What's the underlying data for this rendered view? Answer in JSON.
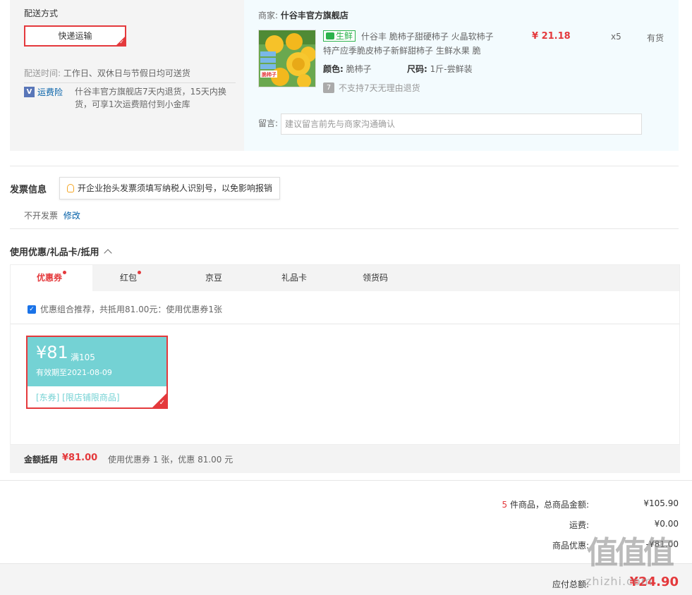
{
  "shipping": {
    "title": "配送方式",
    "method": "快递运输",
    "time_label": "配送时间:",
    "time_value": "工作日、双休日与节假日均可送货",
    "insurance_icon": "V",
    "insurance_label": "运费险",
    "insurance_desc": "什谷丰官方旗舰店7天内退货，15天内换货，可享1次运费赔付到小金库"
  },
  "vendor": {
    "label": "商家:",
    "name": "什谷丰官方旗舰店",
    "product": {
      "fresh_tag": "生鲜",
      "title": "什谷丰 脆柿子甜硬柿子 火晶软柿子特产应季脆皮柿子新鲜甜柿子 生鲜水果 脆",
      "price": "¥ 21.18",
      "qty": "x5",
      "stock": "有货",
      "color_label": "颜色:",
      "color_value": "脆柿子",
      "size_label": "尺码:",
      "size_value": "1斤-尝鲜装",
      "return_icon": "7",
      "return_text": "不支持7天无理由退货",
      "image_caption": "脆柿子"
    },
    "note_label": "留言:",
    "note_placeholder": "建议留言前先与商家沟通确认"
  },
  "invoice": {
    "title": "发票信息",
    "tip": "开企业抬头发票须填写纳税人识别号，以免影响报销",
    "value": "不开发票",
    "edit": "修改"
  },
  "discount": {
    "title": "使用优惠/礼品卡/抵用",
    "tabs": [
      {
        "label": "优惠券",
        "dot": true
      },
      {
        "label": "红包",
        "dot": true
      },
      {
        "label": "京豆",
        "dot": false
      },
      {
        "label": "礼品卡",
        "dot": false
      },
      {
        "label": "领货码",
        "dot": false
      }
    ],
    "combo_text": "优惠组合推荐，共抵用81.00元：使用优惠券1张",
    "coupon": {
      "amount": "¥81",
      "condition": "满105",
      "expire": "有效期至2021-08-09",
      "scope": "[东券] [限店铺限商品]"
    },
    "summary_label": "金额抵用",
    "summary_amount": "¥81.00",
    "summary_detail": "使用优惠券 1 张，优惠 81.00 元"
  },
  "totals": {
    "count": "5",
    "items_label": " 件商品，总商品金额:",
    "items_value": "¥105.90",
    "freight_label": "运费:",
    "freight_value": "¥0.00",
    "discount_label": "商品优惠:",
    "discount_value": "-¥81.00",
    "pay_label": "应付总额:",
    "pay_value": "¥24.90"
  },
  "watermark": {
    "main": "值值值",
    "sub": "zhizhi.com"
  },
  "colors": {
    "accent": "#e4393c",
    "link": "#005ea7",
    "coupon": "#74d2d4",
    "fresh": "#2bb24c"
  }
}
